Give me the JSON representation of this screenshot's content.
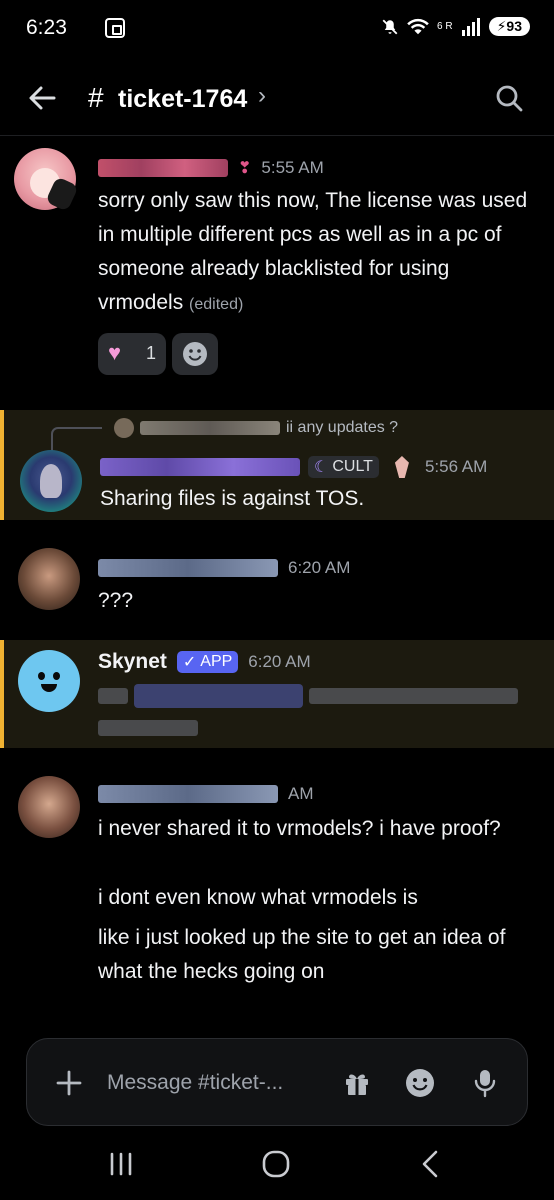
{
  "status_bar": {
    "time": "6:23",
    "network": "6 R",
    "battery": "93"
  },
  "header": {
    "hash": "#",
    "channel": "ticket-1764",
    "chevron": "›"
  },
  "messages": [
    {
      "time": "5:55 AM",
      "text": "sorry only saw this now, The license was used in multiple different pcs as well as in a pc of someone already blacklisted for using vrmodels",
      "edited": "(edited)",
      "reactions": [
        {
          "count": "1"
        }
      ]
    },
    {
      "reply_snippet": "ii any updates ?",
      "badge": "CULT",
      "time": "5:56 AM",
      "text": "Sharing files is against TOS."
    },
    {
      "time": "6:20 AM",
      "text": "???"
    },
    {
      "author": "Skynet",
      "app_badge": "APP",
      "time": "6:20 AM"
    },
    {
      "time": "AM",
      "lines": [
        "i never shared it to vrmodels? i have proof?",
        "i dont even know what vrmodels is",
        "like i just looked up the site to get an idea of what the hecks going on"
      ]
    }
  ],
  "composer": {
    "placeholder": "Message #ticket-..."
  },
  "colors": {
    "accent": "#5865f2",
    "highlight_border": "#f0b232",
    "background": "#000000"
  }
}
